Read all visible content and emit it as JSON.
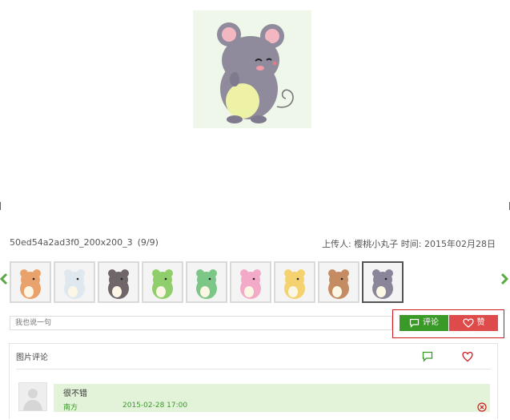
{
  "photo": {
    "filename": "50ed54a2ad3f0_200x200_3",
    "position": "(9/9)",
    "uploader_label": "上传人:",
    "uploader": "樱桃小丸子",
    "time_label": "时间:",
    "date": "2015年02月28日"
  },
  "thumbnails": [
    {
      "name": "fox",
      "color": "#e9a26b",
      "active": false
    },
    {
      "name": "hamster",
      "color": "#dfe7ef",
      "active": false
    },
    {
      "name": "horse",
      "color": "#6e6668",
      "active": false
    },
    {
      "name": "snake",
      "color": "#8fce6a",
      "active": false
    },
    {
      "name": "dragon",
      "color": "#7cc787",
      "active": false
    },
    {
      "name": "rabbit",
      "color": "#f3a9c8",
      "active": false
    },
    {
      "name": "tiger",
      "color": "#f3d26f",
      "active": false
    },
    {
      "name": "boar",
      "color": "#c58c63",
      "active": false
    },
    {
      "name": "mouse",
      "color": "#8a8599",
      "active": true
    }
  ],
  "comment_box": {
    "placeholder": "我也说一句",
    "comment_button": "评论",
    "like_button": "赞"
  },
  "comments_panel": {
    "title": "图片评论"
  },
  "comments": [
    {
      "text": "很不错",
      "user": "南方",
      "time": "2015-02-28 17:00"
    }
  ],
  "icons": {
    "comment": "speech-bubble-icon",
    "like": "heart-icon",
    "delete": "circle-x-icon",
    "prev": "chevron-left-icon",
    "next": "chevron-right-icon"
  },
  "colors": {
    "green": "#3a9a28",
    "red": "#dd4b4b",
    "highlight_border": "#d0191f",
    "comment_bg": "#e2f3d9"
  }
}
